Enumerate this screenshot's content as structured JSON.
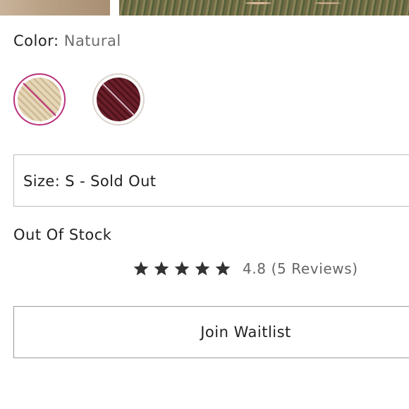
{
  "product": {
    "color_label": "Color:",
    "selected_color": "Natural",
    "swatches": [
      {
        "name": "Natural",
        "color": "#e3d3b3",
        "selected": true,
        "unavailable": true
      },
      {
        "name": "Wine",
        "color": "#6b1f2a",
        "selected": false,
        "unavailable": true
      }
    ],
    "size_select": {
      "label": "Size:",
      "value": "S - Sold Out"
    },
    "stock_status": "Out Of Stock",
    "rating": {
      "stars": 5,
      "score": "4.8",
      "reviews_text": "(5 Reviews)"
    },
    "waitlist_button": "Join Waitlist"
  },
  "colors": {
    "selected_ring": "#b9317a",
    "unselected_ring": "#d9d4cc",
    "strike": "#b9317a",
    "text": "#222222",
    "muted_text": "#6d6d6d",
    "star": "#333333",
    "border": "#bdbdbd"
  }
}
